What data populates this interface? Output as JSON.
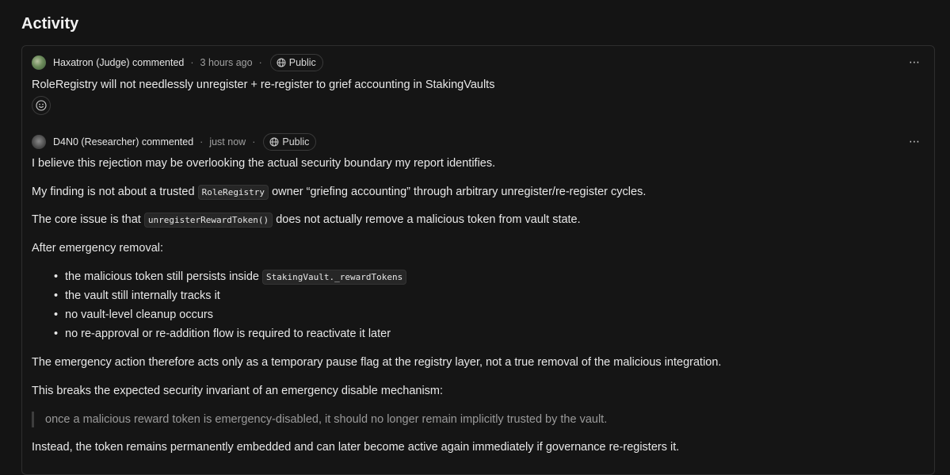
{
  "page": {
    "title": "Activity"
  },
  "comments": [
    {
      "author": "Haxatron (Judge) commented",
      "time": "3 hours ago",
      "visibility": "Public",
      "more_icon": "more-horizontal-icon",
      "text": "RoleRegistry will not needlessly unregister + re-register to grief accounting in StakingVaults"
    },
    {
      "author": "D4N0 (Researcher) commented",
      "time": "just now",
      "visibility": "Public",
      "more_icon": "more-horizontal-icon",
      "p1": "I believe this rejection may be overlooking the actual security boundary my report identifies.",
      "p2_before": "My finding is not about a trusted",
      "p2_code": "RoleRegistry",
      "p2_after": "owner “griefing accounting” through arbitrary unregister/re-register cycles.",
      "p3_before": "The core issue is that",
      "p3_code": "unregisterRewardToken()",
      "p3_after": "does not actually remove a malicious token from vault state.",
      "p4": "After emergency removal:",
      "bullet1_before": "the malicious token still persists inside",
      "bullet1_code": "StakingVault._rewardTokens",
      "bullet2": "the vault still internally tracks it",
      "bullet3": "no vault-level cleanup occurs",
      "bullet4": "no re-approval or re-addition flow is required to reactivate it later",
      "p5": "The emergency action therefore acts only as a temporary pause flag at the registry layer, not a true removal of the malicious integration.",
      "p6": "This breaks the expected security invariant of an emergency disable mechanism:",
      "quote": "once a malicious reward token is emergency-disabled, it should no longer remain implicitly trusted by the vault.",
      "p7": "Instead, the token remains permanently embedded and can later become active again immediately if governance re-registers it."
    }
  ]
}
